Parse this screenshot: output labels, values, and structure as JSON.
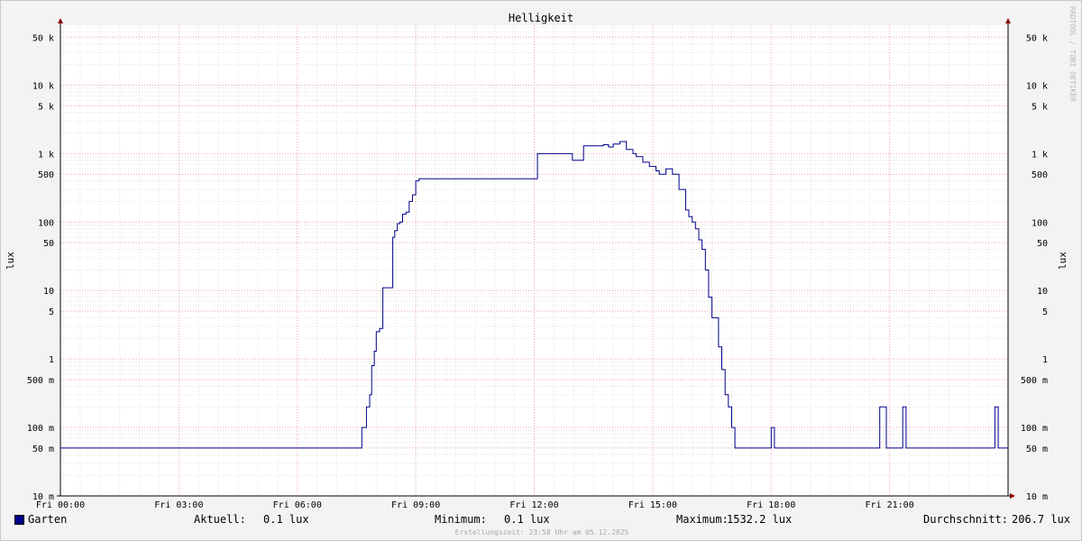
{
  "chart_data": {
    "type": "line",
    "title": "Helligkeit",
    "ylabel": "lux",
    "y_scale": "log",
    "ylim": [
      0.01,
      75000
    ],
    "y_ticks": [
      {
        "value": 50000,
        "label": "50 k"
      },
      {
        "value": 10000,
        "label": "10 k"
      },
      {
        "value": 5000,
        "label": "5 k"
      },
      {
        "value": 1000,
        "label": "1 k"
      },
      {
        "value": 500,
        "label": "500"
      },
      {
        "value": 100,
        "label": "100"
      },
      {
        "value": 50,
        "label": "50"
      },
      {
        "value": 10,
        "label": "10"
      },
      {
        "value": 5,
        "label": "5"
      },
      {
        "value": 1,
        "label": "1"
      },
      {
        "value": 0.5,
        "label": "500 m"
      },
      {
        "value": 0.1,
        "label": "100 m"
      },
      {
        "value": 0.05,
        "label": "50 m"
      },
      {
        "value": 0.01,
        "label": "10 m"
      }
    ],
    "xlim": [
      "00:00",
      "24:00"
    ],
    "x_ticks": [
      {
        "value": "00:00",
        "label": "Fri 00:00"
      },
      {
        "value": "03:00",
        "label": "Fri 03:00"
      },
      {
        "value": "06:00",
        "label": "Fri 06:00"
      },
      {
        "value": "09:00",
        "label": "Fri 09:00"
      },
      {
        "value": "12:00",
        "label": "Fri 12:00"
      },
      {
        "value": "15:00",
        "label": "Fri 15:00"
      },
      {
        "value": "18:00",
        "label": "Fri 18:00"
      },
      {
        "value": "21:00",
        "label": "Fri 21:00"
      }
    ],
    "grid": true,
    "series": [
      {
        "name": "Garten",
        "color": "#00008b",
        "x": [
          "00:00",
          "07:35",
          "07:38",
          "07:45",
          "07:50",
          "07:53",
          "07:57",
          "08:00",
          "08:05",
          "08:10",
          "08:15",
          "08:20",
          "08:25",
          "08:28",
          "08:32",
          "08:36",
          "08:40",
          "08:45",
          "08:50",
          "08:55",
          "09:00",
          "09:05",
          "09:10",
          "09:15",
          "09:20",
          "09:30",
          "12:00",
          "12:05",
          "12:40",
          "12:58",
          "13:15",
          "13:35",
          "13:45",
          "13:53",
          "14:00",
          "14:10",
          "14:20",
          "14:30",
          "14:35",
          "14:45",
          "14:55",
          "15:05",
          "15:10",
          "15:20",
          "15:30",
          "15:40",
          "15:50",
          "15:55",
          "16:00",
          "16:05",
          "16:10",
          "16:15",
          "16:20",
          "16:25",
          "16:30",
          "16:40",
          "16:45",
          "16:50",
          "16:55",
          "17:00",
          "17:05",
          "17:10",
          "17:15",
          "17:20",
          "17:25",
          "17:55",
          "18:00",
          "18:05",
          "20:40",
          "20:45",
          "20:55",
          "21:00",
          "21:20",
          "21:25",
          "21:40",
          "21:45",
          "23:35",
          "23:40",
          "23:45",
          "24:00"
        ],
        "y": [
          0.05,
          0.05,
          0.1,
          0.2,
          0.3,
          0.8,
          1.3,
          2.5,
          2.8,
          11,
          11,
          11,
          60,
          75,
          95,
          100,
          130,
          140,
          200,
          250,
          400,
          430,
          430,
          430,
          430,
          430,
          430,
          1000,
          1000,
          800,
          1300,
          1300,
          1350,
          1250,
          1380,
          1500,
          1150,
          1000,
          900,
          750,
          650,
          560,
          500,
          600,
          500,
          300,
          150,
          120,
          100,
          80,
          55,
          40,
          20,
          8,
          4,
          1.5,
          0.7,
          0.3,
          0.2,
          0.1,
          0.05,
          0.05,
          0.05,
          0.05,
          0.05,
          0.05,
          0.1,
          0.05,
          0.05,
          0.2,
          0.05,
          0.05,
          0.2,
          0.05,
          0.05,
          0.05,
          0.05,
          0.2,
          0.05,
          0.05
        ]
      }
    ]
  },
  "legend": {
    "series_name": "Garten",
    "current_label": "Aktuell:",
    "current_value": "0.1 lux",
    "min_label": "Minimum:",
    "min_value": "0.1 lux",
    "max_label": "Maximum:",
    "max_value": "1532.2 lux",
    "avg_label": "Durchschnitt:",
    "avg_value": "206.7 lux"
  },
  "footer": {
    "timestamp": "Erstellungszeit: 23:58 Uhr am 05.12.2025"
  },
  "watermark": {
    "text": "RRDTOOL / TOBI OETIKER"
  }
}
